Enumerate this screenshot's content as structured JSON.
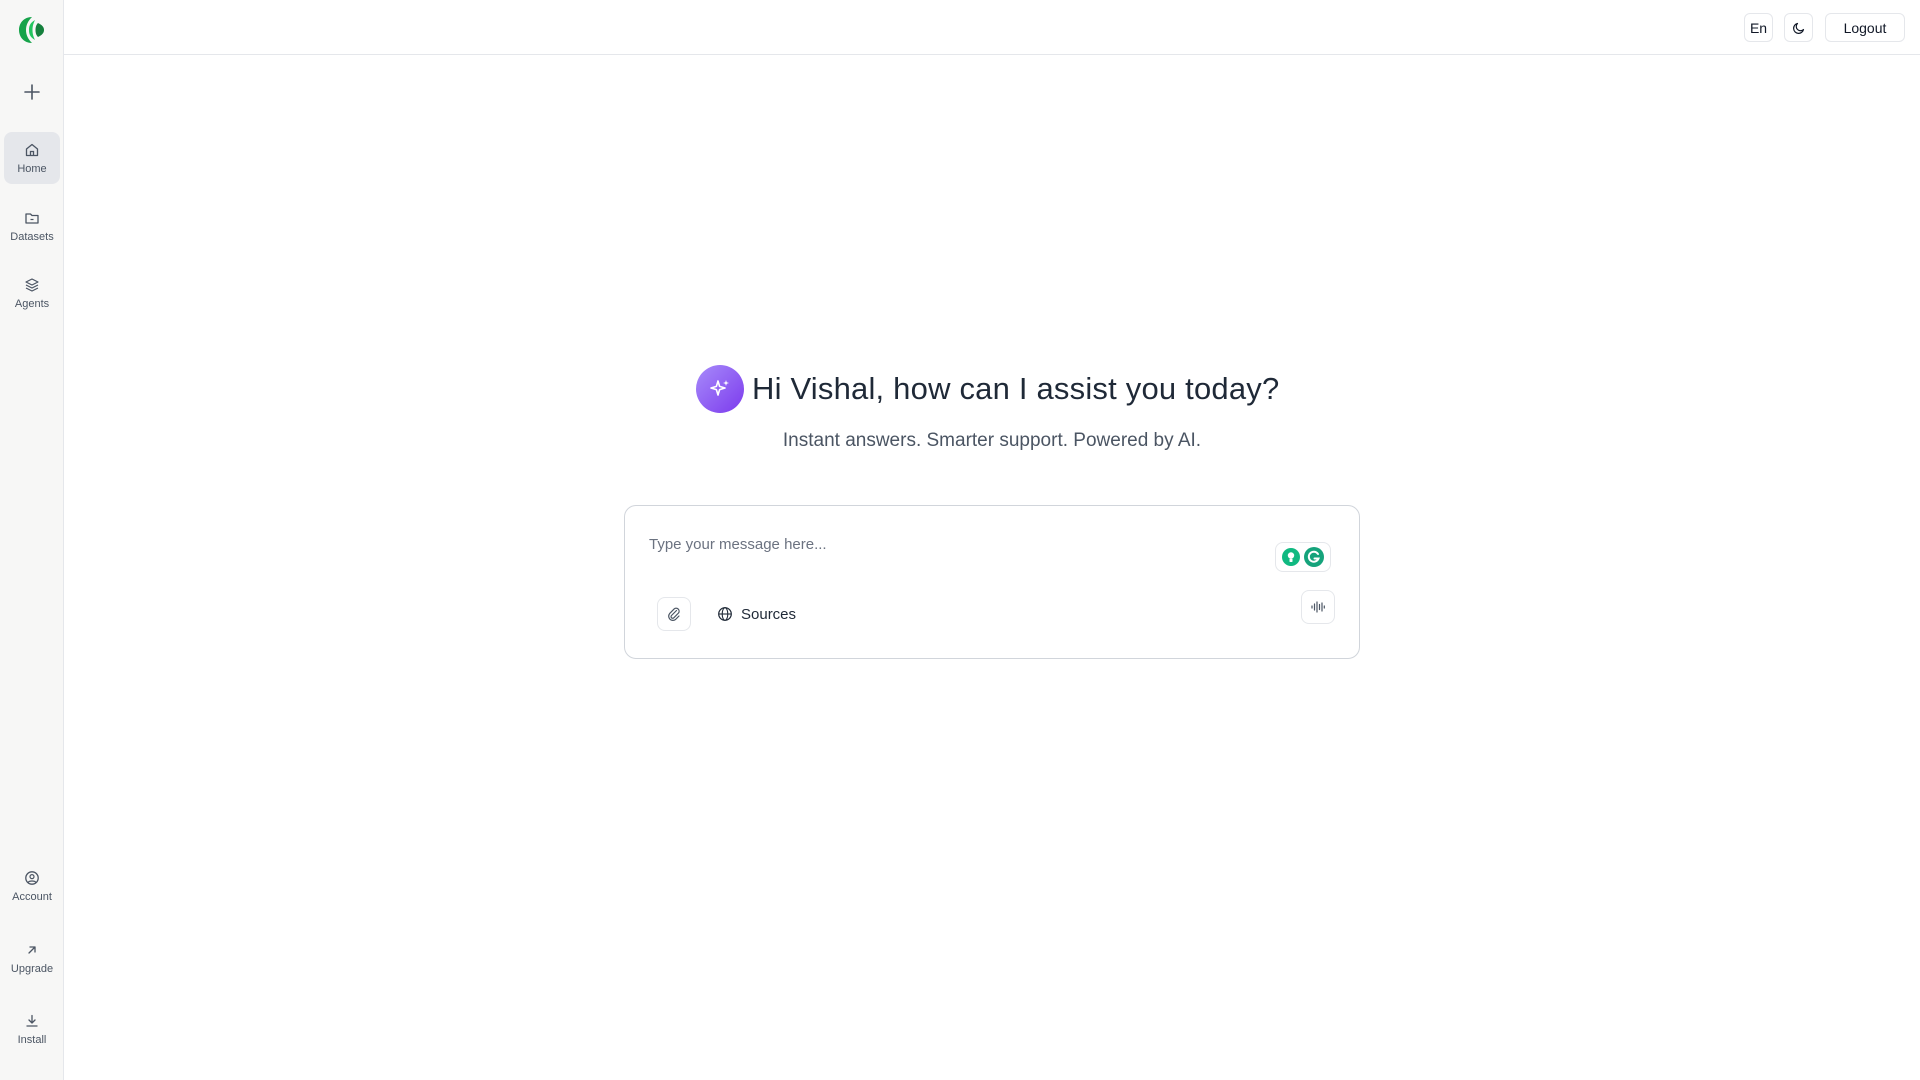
{
  "sidebar": {
    "new_chat_icon": "plus-icon",
    "items": [
      {
        "label": "Home",
        "icon": "home-icon",
        "active": true
      },
      {
        "label": "Datasets",
        "icon": "folder-icon",
        "active": false
      },
      {
        "label": "Agents",
        "icon": "layers-icon",
        "active": false
      }
    ],
    "bottom_items": [
      {
        "label": "Account",
        "icon": "user-circle-icon"
      },
      {
        "label": "Upgrade",
        "icon": "arrow-up-right-icon"
      },
      {
        "label": "Install",
        "icon": "download-icon"
      }
    ]
  },
  "header": {
    "language": "En",
    "theme_icon": "moon-icon",
    "logout_label": "Logout"
  },
  "hero": {
    "greeting": "Hi Vishal, how can I assist you today?",
    "subtitle": "Instant answers. Smarter support. Powered by AI."
  },
  "composer": {
    "placeholder": "Type your message here...",
    "value": "",
    "sources_label": "Sources"
  },
  "colors": {
    "accent_gradient_start": "#a78bfa",
    "accent_gradient_end": "#7c3aed",
    "brand_green": "#16a34a"
  }
}
